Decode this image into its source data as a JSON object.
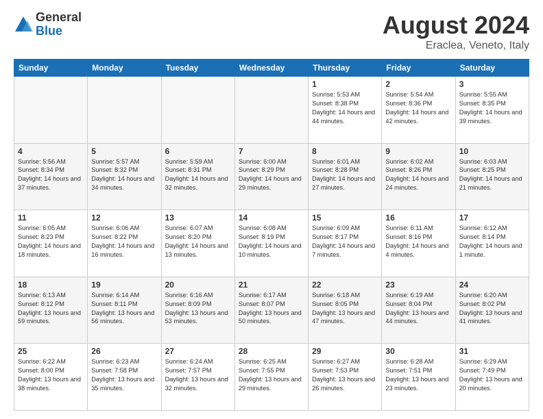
{
  "logo": {
    "general": "General",
    "blue": "Blue"
  },
  "header": {
    "title": "August 2024",
    "subtitle": "Eraclea, Veneto, Italy"
  },
  "weekdays": [
    "Sunday",
    "Monday",
    "Tuesday",
    "Wednesday",
    "Thursday",
    "Friday",
    "Saturday"
  ],
  "weeks": [
    [
      {
        "day": "",
        "empty": true
      },
      {
        "day": "",
        "empty": true
      },
      {
        "day": "",
        "empty": true
      },
      {
        "day": "",
        "empty": true
      },
      {
        "day": "1",
        "sunrise": "5:53 AM",
        "sunset": "8:38 PM",
        "daylight": "14 hours and 44 minutes."
      },
      {
        "day": "2",
        "sunrise": "5:54 AM",
        "sunset": "8:36 PM",
        "daylight": "14 hours and 42 minutes."
      },
      {
        "day": "3",
        "sunrise": "5:55 AM",
        "sunset": "8:35 PM",
        "daylight": "14 hours and 39 minutes."
      }
    ],
    [
      {
        "day": "4",
        "sunrise": "5:56 AM",
        "sunset": "8:34 PM",
        "daylight": "14 hours and 37 minutes."
      },
      {
        "day": "5",
        "sunrise": "5:57 AM",
        "sunset": "8:32 PM",
        "daylight": "14 hours and 34 minutes."
      },
      {
        "day": "6",
        "sunrise": "5:59 AM",
        "sunset": "8:31 PM",
        "daylight": "14 hours and 32 minutes."
      },
      {
        "day": "7",
        "sunrise": "6:00 AM",
        "sunset": "8:29 PM",
        "daylight": "14 hours and 29 minutes."
      },
      {
        "day": "8",
        "sunrise": "6:01 AM",
        "sunset": "8:28 PM",
        "daylight": "14 hours and 27 minutes."
      },
      {
        "day": "9",
        "sunrise": "6:02 AM",
        "sunset": "8:26 PM",
        "daylight": "14 hours and 24 minutes."
      },
      {
        "day": "10",
        "sunrise": "6:03 AM",
        "sunset": "8:25 PM",
        "daylight": "14 hours and 21 minutes."
      }
    ],
    [
      {
        "day": "11",
        "sunrise": "6:05 AM",
        "sunset": "8:23 PM",
        "daylight": "14 hours and 18 minutes."
      },
      {
        "day": "12",
        "sunrise": "6:06 AM",
        "sunset": "8:22 PM",
        "daylight": "14 hours and 16 minutes."
      },
      {
        "day": "13",
        "sunrise": "6:07 AM",
        "sunset": "8:20 PM",
        "daylight": "14 hours and 13 minutes."
      },
      {
        "day": "14",
        "sunrise": "6:08 AM",
        "sunset": "8:19 PM",
        "daylight": "14 hours and 10 minutes."
      },
      {
        "day": "15",
        "sunrise": "6:09 AM",
        "sunset": "8:17 PM",
        "daylight": "14 hours and 7 minutes."
      },
      {
        "day": "16",
        "sunrise": "6:11 AM",
        "sunset": "8:16 PM",
        "daylight": "14 hours and 4 minutes."
      },
      {
        "day": "17",
        "sunrise": "6:12 AM",
        "sunset": "8:14 PM",
        "daylight": "14 hours and 1 minute."
      }
    ],
    [
      {
        "day": "18",
        "sunrise": "6:13 AM",
        "sunset": "8:12 PM",
        "daylight": "13 hours and 59 minutes."
      },
      {
        "day": "19",
        "sunrise": "6:14 AM",
        "sunset": "8:11 PM",
        "daylight": "13 hours and 56 minutes."
      },
      {
        "day": "20",
        "sunrise": "6:16 AM",
        "sunset": "8:09 PM",
        "daylight": "13 hours and 53 minutes."
      },
      {
        "day": "21",
        "sunrise": "6:17 AM",
        "sunset": "8:07 PM",
        "daylight": "13 hours and 50 minutes."
      },
      {
        "day": "22",
        "sunrise": "6:18 AM",
        "sunset": "8:05 PM",
        "daylight": "13 hours and 47 minutes."
      },
      {
        "day": "23",
        "sunrise": "6:19 AM",
        "sunset": "8:04 PM",
        "daylight": "13 hours and 44 minutes."
      },
      {
        "day": "24",
        "sunrise": "6:20 AM",
        "sunset": "8:02 PM",
        "daylight": "13 hours and 41 minutes."
      }
    ],
    [
      {
        "day": "25",
        "sunrise": "6:22 AM",
        "sunset": "8:00 PM",
        "daylight": "13 hours and 38 minutes."
      },
      {
        "day": "26",
        "sunrise": "6:23 AM",
        "sunset": "7:58 PM",
        "daylight": "13 hours and 35 minutes."
      },
      {
        "day": "27",
        "sunrise": "6:24 AM",
        "sunset": "7:57 PM",
        "daylight": "13 hours and 32 minutes."
      },
      {
        "day": "28",
        "sunrise": "6:25 AM",
        "sunset": "7:55 PM",
        "daylight": "13 hours and 29 minutes."
      },
      {
        "day": "29",
        "sunrise": "6:27 AM",
        "sunset": "7:53 PM",
        "daylight": "13 hours and 26 minutes."
      },
      {
        "day": "30",
        "sunrise": "6:28 AM",
        "sunset": "7:51 PM",
        "daylight": "13 hours and 23 minutes."
      },
      {
        "day": "31",
        "sunrise": "6:29 AM",
        "sunset": "7:49 PM",
        "daylight": "13 hours and 20 minutes."
      }
    ]
  ]
}
